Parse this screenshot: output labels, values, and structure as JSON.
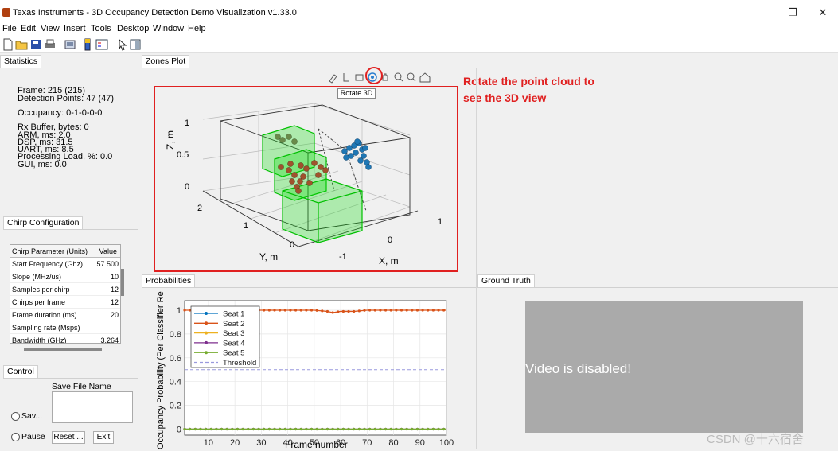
{
  "window": {
    "title": "Texas Instruments - 3D Occupancy Detection Demo Visualization v1.33.0",
    "controls": [
      "—",
      "❐",
      "✕"
    ]
  },
  "menu": [
    "File",
    "Edit",
    "View",
    "Insert",
    "Tools",
    "Desktop",
    "Window",
    "Help"
  ],
  "toolbar_icons": [
    "new-file-icon",
    "open-folder-icon",
    "save-icon",
    "print-icon",
    "link-figure-icon",
    "colorbar-icon",
    "legend-icon",
    "pointer-icon",
    "property-editor-icon"
  ],
  "statistics": {
    "tab": "Statistics",
    "frame": "Frame: 215 (215)",
    "detection_points": "Detection Points: 47 (47)",
    "occupancy": "Occupancy: 0-1-0-0-0",
    "rx_buffer": "Rx Buffer, bytes: 0",
    "arm": "ARM, ms: 2.0",
    "dsp": "DSP, ms: 31.5",
    "uart": "UART, ms: 8.5",
    "processing_load": "Processing Load, %: 0.0",
    "gui": "GUI, ms: 0.0"
  },
  "chirp": {
    "tab": "Chirp Configuration",
    "header": [
      "Chirp Parameter (Units)",
      "Value"
    ],
    "rows": [
      [
        "Start Frequency (Ghz)",
        "57.500"
      ],
      [
        "Slope (MHz/us)",
        "10"
      ],
      [
        "Samples per chirp",
        "12"
      ],
      [
        "Chirps per frame",
        "12"
      ],
      [
        "Frame duration (ms)",
        "20"
      ],
      [
        "Sampling rate (Msps)",
        ""
      ],
      [
        "Bandwidth (GHz)",
        "3.264"
      ]
    ]
  },
  "control": {
    "tab": "Control",
    "save_file_label": "Save File Name",
    "save_radio": "Sav...",
    "pause_radio": "Pause",
    "reset_button": "Reset ...",
    "exit_button": "Exit"
  },
  "zones": {
    "tab": "Zones Plot",
    "tooltip": "Rotate 3D",
    "axis_tools": [
      "brush-icon",
      "data-tip-icon",
      "camera-icon",
      "rotate-3d-icon",
      "pan-icon",
      "zoom-in-icon",
      "zoom-out-icon",
      "home-icon"
    ],
    "z_label": "Z, m",
    "y_label": "Y, m",
    "x_label": "X, m",
    "z_ticks": [
      "1",
      "0.5",
      "0"
    ],
    "y_ticks": [
      "2",
      "1",
      "0"
    ],
    "x_ticks": [
      "1",
      "0",
      "-1"
    ]
  },
  "annotation": {
    "line1": "Rotate the point cloud to",
    "line2": "see the 3D view"
  },
  "probabilities": {
    "tab": "Probabilities",
    "ylabel": "Occupancy Probability (Per Classifier Re",
    "xlabel": "Frame number"
  },
  "ground_truth": {
    "tab": "Ground Truth",
    "video_text": "Video is disabled!"
  },
  "watermark": "CSDN @十六宿舍",
  "colors": {
    "seat1": "#0072bd",
    "seat2": "#d95319",
    "seat3": "#edb120",
    "seat4": "#7e2f8e",
    "seat5": "#77ac30",
    "threshold": "#9999dd",
    "zone_box": "#00e000",
    "annotation": "#e02020"
  },
  "chart_data": {
    "type": "line",
    "x": [
      1,
      5,
      10,
      15,
      20,
      25,
      30,
      35,
      40,
      45,
      50,
      55,
      57,
      60,
      65,
      70,
      75,
      80,
      85,
      90,
      95,
      100
    ],
    "series": [
      {
        "name": "Seat 1",
        "values": [
          0,
          0,
          0,
          0,
          0,
          0,
          0,
          0,
          0,
          0,
          0,
          0,
          0,
          0,
          0,
          0,
          0,
          0,
          0,
          0,
          0,
          0
        ]
      },
      {
        "name": "Seat 2",
        "values": [
          1,
          1,
          1,
          1,
          1,
          1,
          1,
          1,
          1,
          1,
          1,
          0.99,
          0.98,
          0.99,
          0.99,
          1,
          1,
          1,
          1,
          1,
          1,
          1
        ]
      },
      {
        "name": "Seat 3",
        "values": [
          0,
          0,
          0,
          0,
          0,
          0,
          0,
          0,
          0,
          0,
          0,
          0,
          0,
          0,
          0,
          0,
          0,
          0,
          0,
          0,
          0,
          0
        ]
      },
      {
        "name": "Seat 4",
        "values": [
          0,
          0,
          0,
          0,
          0,
          0,
          0,
          0,
          0,
          0,
          0,
          0,
          0,
          0,
          0,
          0,
          0,
          0,
          0,
          0,
          0,
          0
        ]
      },
      {
        "name": "Seat 5",
        "values": [
          0,
          0,
          0,
          0,
          0,
          0,
          0,
          0,
          0,
          0,
          0,
          0,
          0,
          0,
          0,
          0,
          0,
          0,
          0,
          0,
          0,
          0
        ]
      }
    ],
    "threshold": {
      "name": "Threshold",
      "value": 0.5
    },
    "xlim": [
      1,
      100
    ],
    "ylim": [
      -0.05,
      1.08
    ],
    "xticks": [
      10,
      20,
      30,
      40,
      50,
      60,
      70,
      80,
      90,
      100
    ],
    "yticks": [
      0,
      0.2,
      0.4,
      0.6,
      0.8,
      1
    ],
    "xlabel": "Frame number",
    "ylabel": "Occupancy Probability (Per Classifier Re",
    "grid": true,
    "legend_position": "top-left"
  }
}
